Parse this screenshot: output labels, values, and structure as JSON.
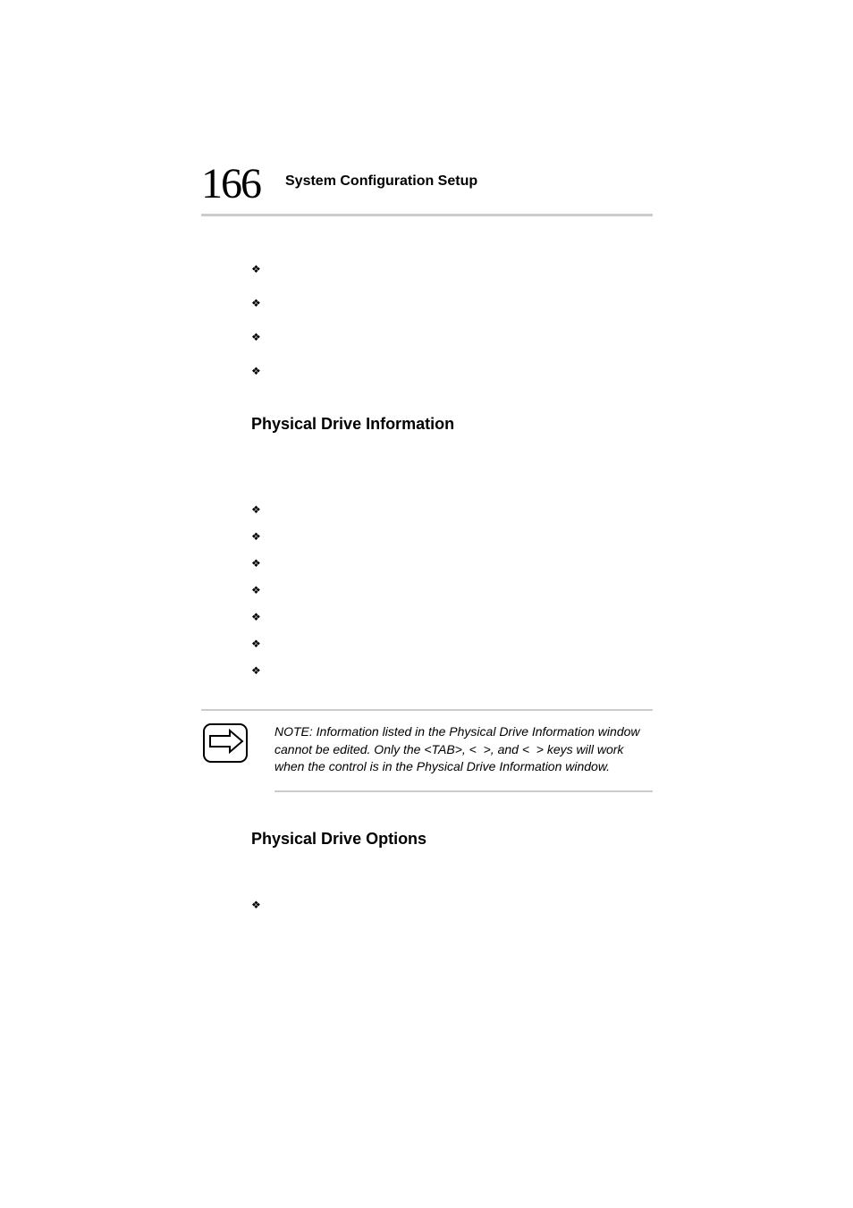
{
  "header": {
    "page_number": "166",
    "title": "System Configuration Setup"
  },
  "bullets_top": [
    "",
    "",
    "",
    ""
  ],
  "section1": {
    "heading": "Physical Drive Information",
    "bullets": [
      "",
      "",
      "",
      "",
      "",
      "",
      ""
    ]
  },
  "note": {
    "text": "NOTE: Information listed in the Physical Drive Information window cannot be edited.  Only the <TAB>, <  >, and <  > keys will work when the control is in the Physical Drive Information window."
  },
  "section2": {
    "heading": "Physical Drive Options",
    "bullets": [
      ""
    ]
  }
}
